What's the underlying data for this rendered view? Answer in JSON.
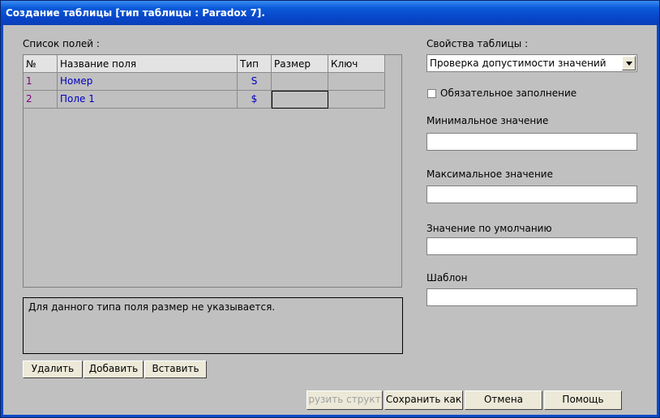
{
  "window": {
    "title": "Создание таблицы [тип таблицы : Paradox 7]."
  },
  "fields": {
    "label": "Список полей :",
    "columns": [
      "№",
      "Название поля",
      "Тип",
      "Размер",
      "Ключ"
    ],
    "rows": [
      {
        "num": "1",
        "name": "Номер",
        "type": "S",
        "size": "",
        "key": ""
      },
      {
        "num": "2",
        "name": "Поле 1",
        "type": "$",
        "size": "",
        "key": ""
      }
    ]
  },
  "info_text": "Для данного типа поля размер не указывается.",
  "field_buttons": {
    "delete": "Удалить",
    "add": "Добавить",
    "insert": "Вставить"
  },
  "properties": {
    "label": "Свойства таблицы :",
    "selected": "Проверка допустимости значений",
    "required_label": "Обязательное заполнение",
    "required_checked": false,
    "min_label": "Минимальное значение",
    "min_value": "",
    "max_label": "Максимальное значение",
    "max_value": "",
    "default_label": "Значение по умолчанию",
    "default_value": "",
    "template_label": "Шаблон",
    "template_value": ""
  },
  "footer_buttons": {
    "load": "рузить структ",
    "save_as": "Сохранить как",
    "cancel": "Отмена",
    "help": "Помощь"
  },
  "colors": {
    "title_bar": "#0a5ad8",
    "row_number": "#800080",
    "field_text": "#0000c0"
  }
}
